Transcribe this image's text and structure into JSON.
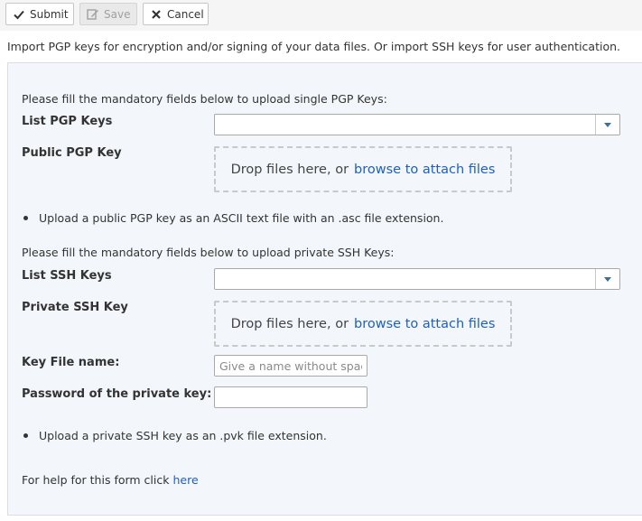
{
  "toolbar": {
    "submit_label": "Submit",
    "save_label": "Save",
    "cancel_label": "Cancel"
  },
  "intro": "Import PGP keys for encryption and/or signing of your data files. Or import SSH keys for user authentication.",
  "pgp": {
    "instruction": "Please fill the mandatory fields below to upload single PGP Keys:",
    "list_label": "List PGP Keys",
    "list_value": "",
    "public_key_label": "Public PGP Key",
    "drop_text": "Drop files here, or",
    "drop_link": "browse to attach files",
    "note": "Upload a public PGP key as an ASCII text file with an .asc file extension."
  },
  "ssh": {
    "instruction": "Please fill the mandatory fields below to upload private SSH Keys:",
    "list_label": "List SSH Keys",
    "list_value": "",
    "private_key_label": "Private SSH Key",
    "drop_text": "Drop files here, or",
    "drop_link": "browse to attach files",
    "key_file_label": "Key File name:",
    "key_file_placeholder": "Give a name without spaces",
    "password_label": "Password of the private key:",
    "password_value": "",
    "note": "Upload a private SSH key as an .pvk file extension."
  },
  "help": {
    "text": "For help for this form click",
    "link": "here"
  },
  "colors": {
    "accent_link": "#1f5fbf",
    "panel_bg": "#f3f6fa"
  }
}
